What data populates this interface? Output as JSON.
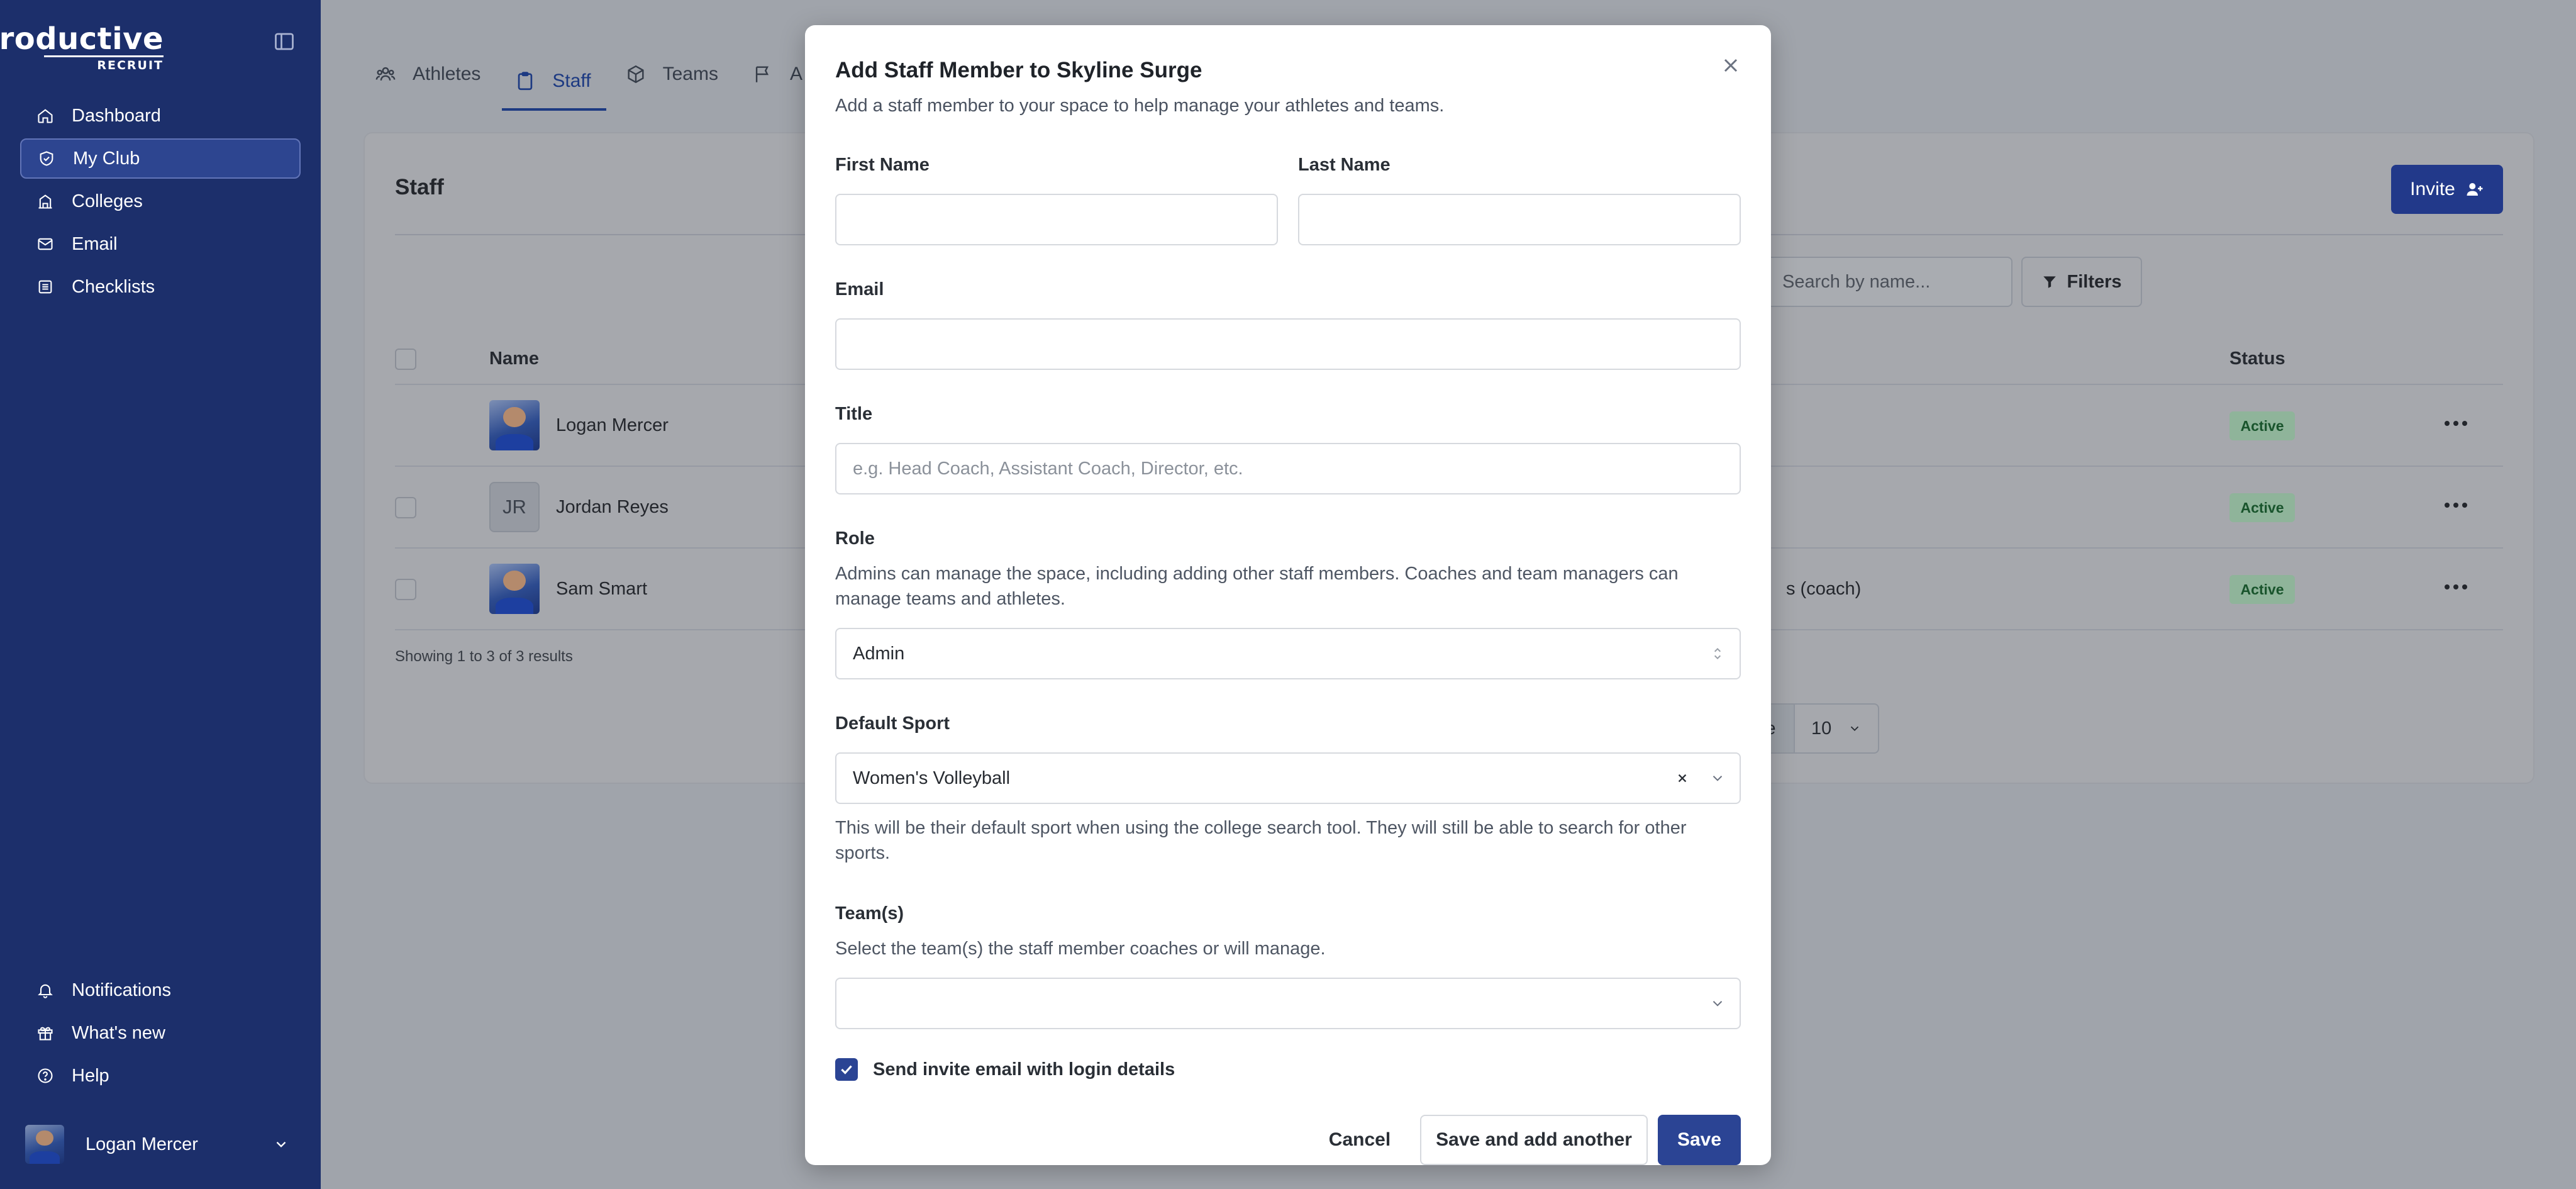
{
  "sidebar": {
    "logo_line1": "Productive",
    "logo_line2": "RECRUIT",
    "nav": [
      {
        "label": "Dashboard",
        "icon": "home-icon"
      },
      {
        "label": "My Club",
        "icon": "shield-icon",
        "active": true
      },
      {
        "label": "Colleges",
        "icon": "building-icon"
      },
      {
        "label": "Email",
        "icon": "mail-icon"
      },
      {
        "label": "Checklists",
        "icon": "list-icon"
      }
    ],
    "bottom_nav": [
      {
        "label": "Notifications",
        "icon": "bell-icon"
      },
      {
        "label": "What's new",
        "icon": "gift-icon"
      },
      {
        "label": "Help",
        "icon": "help-icon"
      }
    ],
    "user_name": "Logan Mercer"
  },
  "tabs": [
    {
      "label": "Athletes",
      "icon": "users-icon"
    },
    {
      "label": "Staff",
      "icon": "clipboard-icon",
      "active": true
    },
    {
      "label": "Teams",
      "icon": "cube-icon"
    },
    {
      "label": "A",
      "icon": "flag-icon"
    }
  ],
  "staff_card": {
    "title": "Staff",
    "invite_label": "Invite",
    "search_placeholder": "Search by name...",
    "filters_label": "Filters",
    "columns": {
      "name": "Name",
      "status": "Status"
    },
    "rows": [
      {
        "name": "Logan Mercer",
        "initials": "",
        "extra": "",
        "status": "Active",
        "has_photo": true
      },
      {
        "name": "Jordan Reyes",
        "initials": "JR",
        "extra": "",
        "status": "Active",
        "has_photo": false
      },
      {
        "name": "Sam Smart",
        "initials": "",
        "extra": "s (coach)",
        "status": "Active",
        "has_photo": true
      }
    ],
    "showing_text": "Showing 1 to 3 of 3 results",
    "per_page_label": "Per Page",
    "per_page_value": "10"
  },
  "modal": {
    "title": "Add Staff Member to Skyline Surge",
    "subtitle": "Add a staff member to your space to help manage your athletes and teams.",
    "first_name_label": "First Name",
    "first_name_value": "",
    "last_name_label": "Last Name",
    "last_name_value": "",
    "email_label": "Email",
    "email_value": "",
    "title_label": "Title",
    "title_placeholder": "e.g. Head Coach, Assistant Coach, Director, etc.",
    "role_label": "Role",
    "role_help_line1": "Admins can manage the space, including adding other staff members. Coaches and team managers can",
    "role_help_line2": "manage teams and athletes.",
    "role_value": "Admin",
    "sport_label": "Default Sport",
    "sport_value": "Women's Volleyball",
    "sport_help_line1": "This will be their default sport when using the college search tool. They will still be able to search for other",
    "sport_help_line2": "sports.",
    "teams_label": "Team(s)",
    "teams_help": "Select the team(s) the staff member coaches or will manage.",
    "teams_value": "",
    "send_invite_label": "Send invite email with login details",
    "send_invite_checked": true,
    "cancel_label": "Cancel",
    "save_another_label": "Save and add another",
    "save_label": "Save"
  },
  "colors": {
    "sidebar_bg": "#1c2f6b",
    "primary": "#2b4494",
    "active_badge_bg": "#8fb49a"
  }
}
